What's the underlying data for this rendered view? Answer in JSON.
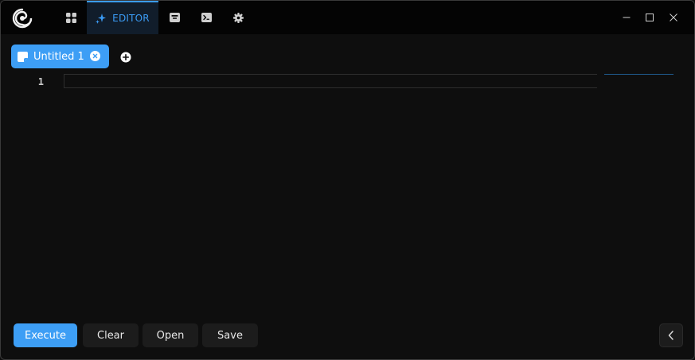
{
  "titlebar": {
    "nav": [
      {
        "icon": "grid-icon",
        "label": ""
      },
      {
        "icon": "sparkle-icon",
        "label": "EDITOR",
        "active": true
      },
      {
        "icon": "inbox-icon",
        "label": ""
      },
      {
        "icon": "terminal-icon",
        "label": ""
      },
      {
        "icon": "gear-icon",
        "label": ""
      }
    ],
    "controls": [
      "minimize-icon",
      "maximize-icon",
      "close-icon"
    ]
  },
  "tabs": [
    {
      "label": "Untitled 1",
      "icon": "file-icon",
      "close_icon": "close-circle-icon",
      "active": true
    }
  ],
  "add_tab_icon": "plus-circle-icon",
  "editor": {
    "line_numbers": [
      "1"
    ],
    "content": ""
  },
  "actions": {
    "execute_label": "Execute",
    "clear_label": "Clear",
    "open_label": "Open",
    "save_label": "Save",
    "collapse_icon": "chevron-left-icon"
  },
  "colors": {
    "accent": "#3d9ef5",
    "background": "#0e0e0e",
    "titlebar": "#040404",
    "button_secondary": "#1c1c1c"
  }
}
